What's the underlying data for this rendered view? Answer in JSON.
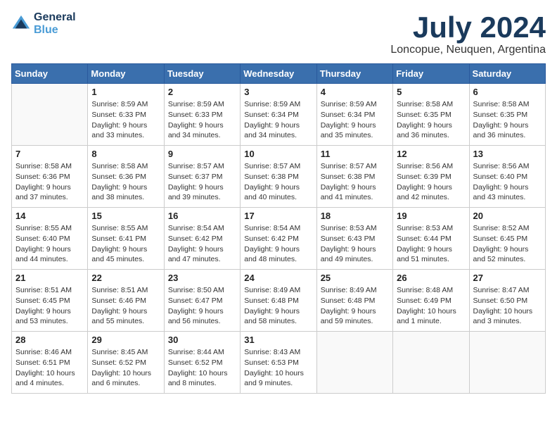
{
  "header": {
    "logo_line1": "General",
    "logo_line2": "Blue",
    "month_title": "July 2024",
    "location": "Loncopue, Neuquen, Argentina"
  },
  "weekdays": [
    "Sunday",
    "Monday",
    "Tuesday",
    "Wednesday",
    "Thursday",
    "Friday",
    "Saturday"
  ],
  "weeks": [
    [
      {
        "day": "",
        "sunrise": "",
        "sunset": "",
        "daylight": ""
      },
      {
        "day": "1",
        "sunrise": "Sunrise: 8:59 AM",
        "sunset": "Sunset: 6:33 PM",
        "daylight": "Daylight: 9 hours and 33 minutes."
      },
      {
        "day": "2",
        "sunrise": "Sunrise: 8:59 AM",
        "sunset": "Sunset: 6:33 PM",
        "daylight": "Daylight: 9 hours and 34 minutes."
      },
      {
        "day": "3",
        "sunrise": "Sunrise: 8:59 AM",
        "sunset": "Sunset: 6:34 PM",
        "daylight": "Daylight: 9 hours and 34 minutes."
      },
      {
        "day": "4",
        "sunrise": "Sunrise: 8:59 AM",
        "sunset": "Sunset: 6:34 PM",
        "daylight": "Daylight: 9 hours and 35 minutes."
      },
      {
        "day": "5",
        "sunrise": "Sunrise: 8:58 AM",
        "sunset": "Sunset: 6:35 PM",
        "daylight": "Daylight: 9 hours and 36 minutes."
      },
      {
        "day": "6",
        "sunrise": "Sunrise: 8:58 AM",
        "sunset": "Sunset: 6:35 PM",
        "daylight": "Daylight: 9 hours and 36 minutes."
      }
    ],
    [
      {
        "day": "7",
        "sunrise": "Sunrise: 8:58 AM",
        "sunset": "Sunset: 6:36 PM",
        "daylight": "Daylight: 9 hours and 37 minutes."
      },
      {
        "day": "8",
        "sunrise": "Sunrise: 8:58 AM",
        "sunset": "Sunset: 6:36 PM",
        "daylight": "Daylight: 9 hours and 38 minutes."
      },
      {
        "day": "9",
        "sunrise": "Sunrise: 8:57 AM",
        "sunset": "Sunset: 6:37 PM",
        "daylight": "Daylight: 9 hours and 39 minutes."
      },
      {
        "day": "10",
        "sunrise": "Sunrise: 8:57 AM",
        "sunset": "Sunset: 6:38 PM",
        "daylight": "Daylight: 9 hours and 40 minutes."
      },
      {
        "day": "11",
        "sunrise": "Sunrise: 8:57 AM",
        "sunset": "Sunset: 6:38 PM",
        "daylight": "Daylight: 9 hours and 41 minutes."
      },
      {
        "day": "12",
        "sunrise": "Sunrise: 8:56 AM",
        "sunset": "Sunset: 6:39 PM",
        "daylight": "Daylight: 9 hours and 42 minutes."
      },
      {
        "day": "13",
        "sunrise": "Sunrise: 8:56 AM",
        "sunset": "Sunset: 6:40 PM",
        "daylight": "Daylight: 9 hours and 43 minutes."
      }
    ],
    [
      {
        "day": "14",
        "sunrise": "Sunrise: 8:55 AM",
        "sunset": "Sunset: 6:40 PM",
        "daylight": "Daylight: 9 hours and 44 minutes."
      },
      {
        "day": "15",
        "sunrise": "Sunrise: 8:55 AM",
        "sunset": "Sunset: 6:41 PM",
        "daylight": "Daylight: 9 hours and 45 minutes."
      },
      {
        "day": "16",
        "sunrise": "Sunrise: 8:54 AM",
        "sunset": "Sunset: 6:42 PM",
        "daylight": "Daylight: 9 hours and 47 minutes."
      },
      {
        "day": "17",
        "sunrise": "Sunrise: 8:54 AM",
        "sunset": "Sunset: 6:42 PM",
        "daylight": "Daylight: 9 hours and 48 minutes."
      },
      {
        "day": "18",
        "sunrise": "Sunrise: 8:53 AM",
        "sunset": "Sunset: 6:43 PM",
        "daylight": "Daylight: 9 hours and 49 minutes."
      },
      {
        "day": "19",
        "sunrise": "Sunrise: 8:53 AM",
        "sunset": "Sunset: 6:44 PM",
        "daylight": "Daylight: 9 hours and 51 minutes."
      },
      {
        "day": "20",
        "sunrise": "Sunrise: 8:52 AM",
        "sunset": "Sunset: 6:45 PM",
        "daylight": "Daylight: 9 hours and 52 minutes."
      }
    ],
    [
      {
        "day": "21",
        "sunrise": "Sunrise: 8:51 AM",
        "sunset": "Sunset: 6:45 PM",
        "daylight": "Daylight: 9 hours and 53 minutes."
      },
      {
        "day": "22",
        "sunrise": "Sunrise: 8:51 AM",
        "sunset": "Sunset: 6:46 PM",
        "daylight": "Daylight: 9 hours and 55 minutes."
      },
      {
        "day": "23",
        "sunrise": "Sunrise: 8:50 AM",
        "sunset": "Sunset: 6:47 PM",
        "daylight": "Daylight: 9 hours and 56 minutes."
      },
      {
        "day": "24",
        "sunrise": "Sunrise: 8:49 AM",
        "sunset": "Sunset: 6:48 PM",
        "daylight": "Daylight: 9 hours and 58 minutes."
      },
      {
        "day": "25",
        "sunrise": "Sunrise: 8:49 AM",
        "sunset": "Sunset: 6:48 PM",
        "daylight": "Daylight: 9 hours and 59 minutes."
      },
      {
        "day": "26",
        "sunrise": "Sunrise: 8:48 AM",
        "sunset": "Sunset: 6:49 PM",
        "daylight": "Daylight: 10 hours and 1 minute."
      },
      {
        "day": "27",
        "sunrise": "Sunrise: 8:47 AM",
        "sunset": "Sunset: 6:50 PM",
        "daylight": "Daylight: 10 hours and 3 minutes."
      }
    ],
    [
      {
        "day": "28",
        "sunrise": "Sunrise: 8:46 AM",
        "sunset": "Sunset: 6:51 PM",
        "daylight": "Daylight: 10 hours and 4 minutes."
      },
      {
        "day": "29",
        "sunrise": "Sunrise: 8:45 AM",
        "sunset": "Sunset: 6:52 PM",
        "daylight": "Daylight: 10 hours and 6 minutes."
      },
      {
        "day": "30",
        "sunrise": "Sunrise: 8:44 AM",
        "sunset": "Sunset: 6:52 PM",
        "daylight": "Daylight: 10 hours and 8 minutes."
      },
      {
        "day": "31",
        "sunrise": "Sunrise: 8:43 AM",
        "sunset": "Sunset: 6:53 PM",
        "daylight": "Daylight: 10 hours and 9 minutes."
      },
      {
        "day": "",
        "sunrise": "",
        "sunset": "",
        "daylight": ""
      },
      {
        "day": "",
        "sunrise": "",
        "sunset": "",
        "daylight": ""
      },
      {
        "day": "",
        "sunrise": "",
        "sunset": "",
        "daylight": ""
      }
    ]
  ]
}
